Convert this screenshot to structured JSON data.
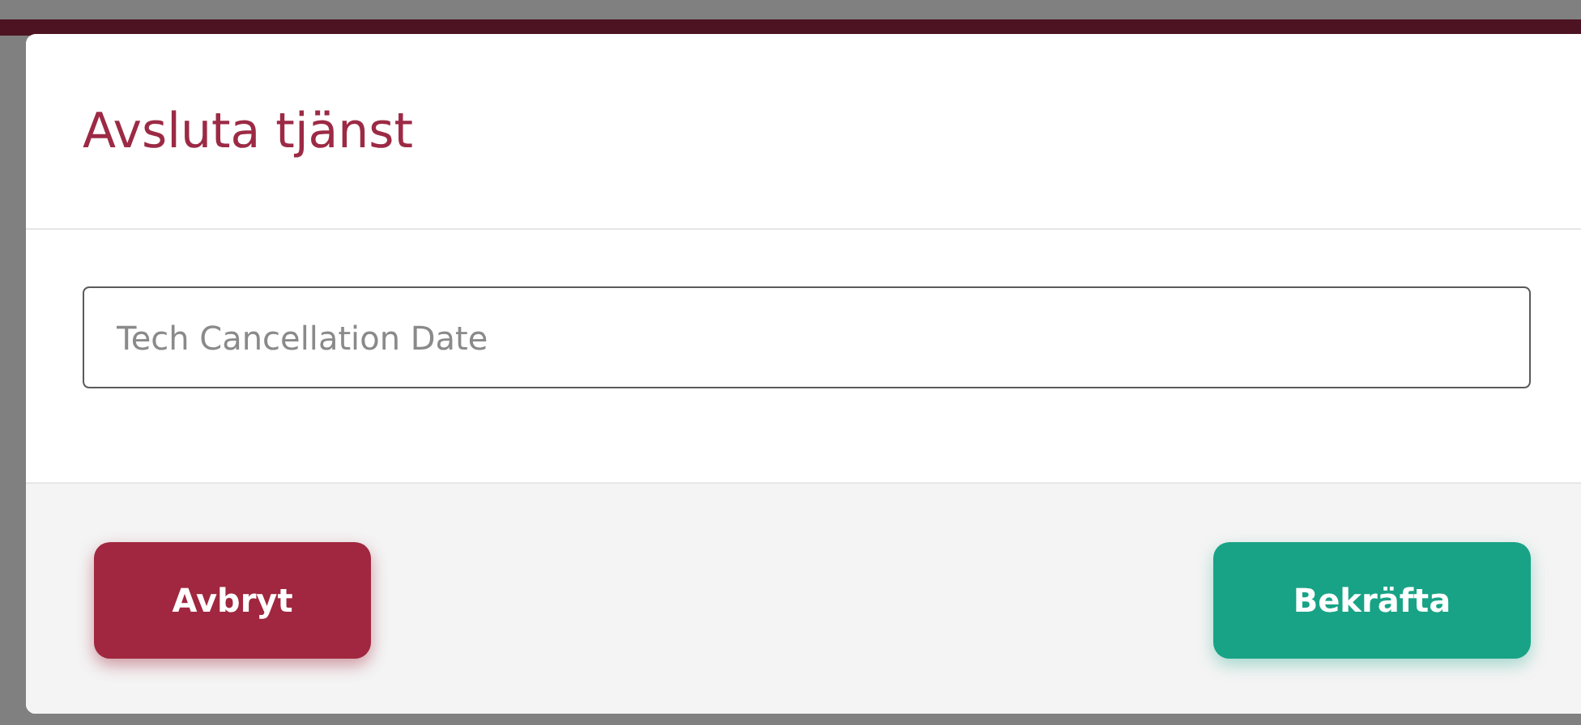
{
  "dialog": {
    "title": "Avsluta tjänst",
    "field": {
      "placeholder": "Tech Cancellation Date"
    },
    "buttons": [
      {
        "kind": "cancel",
        "label": "Avbryt"
      },
      {
        "kind": "confirm",
        "label": "Bekräfta"
      }
    ]
  }
}
